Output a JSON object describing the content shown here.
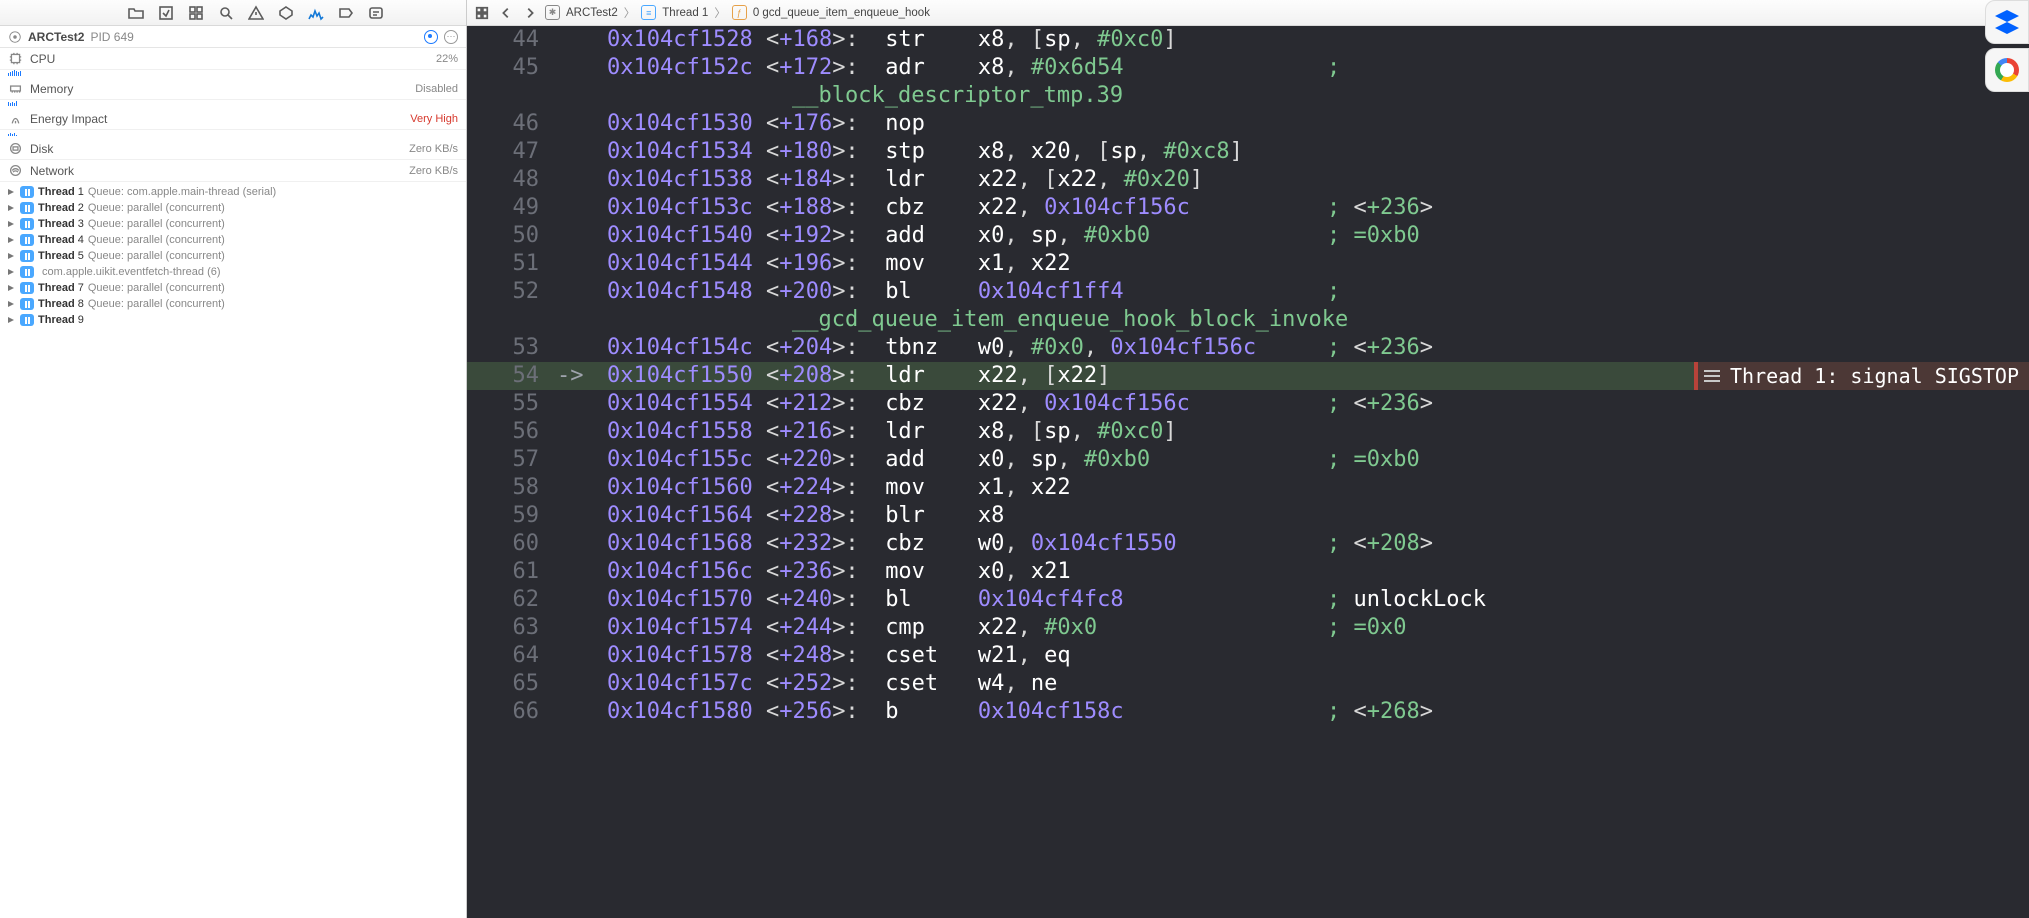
{
  "process": {
    "name": "ARCTest2",
    "pid": "PID 649"
  },
  "gauges": [
    {
      "label": "CPU",
      "value": "22%",
      "cls": "",
      "spark": [
        3,
        4,
        5,
        6,
        5,
        4,
        5
      ]
    },
    {
      "label": "Energy Impact",
      "value": "Very High",
      "cls": "red",
      "spark": [
        2,
        3,
        2,
        3,
        1
      ]
    },
    {
      "label": "Disk",
      "value": "Zero KB/s",
      "cls": "",
      "spark": []
    },
    {
      "label": "Network",
      "value": "Zero KB/s",
      "cls": "",
      "spark": []
    }
  ],
  "memory_status": "Disabled",
  "memory_label": "Memory",
  "threads": [
    {
      "n": "Thread 1",
      "q": "Queue: com.apple.main-thread (serial)"
    },
    {
      "n": "Thread 2",
      "q": "Queue: parallel (concurrent)"
    },
    {
      "n": "Thread 3",
      "q": "Queue: parallel (concurrent)"
    },
    {
      "n": "Thread 4",
      "q": "Queue: parallel (concurrent)"
    },
    {
      "n": "Thread 5",
      "q": "Queue: parallel (concurrent)"
    },
    {
      "n": "",
      "q": "com.apple.uikit.eventfetch-thread (6)"
    },
    {
      "n": "Thread 7",
      "q": "Queue: parallel (concurrent)"
    },
    {
      "n": "Thread 8",
      "q": "Queue: parallel (concurrent)"
    },
    {
      "n": "Thread 9",
      "q": ""
    }
  ],
  "breadcrumb": {
    "project": "ARCTest2",
    "thread": "Thread 1",
    "frame": "0 gcd_queue_item_enqueue_hook"
  },
  "error_banner": "Thread 1: signal SIGSTOP",
  "code": [
    {
      "ln": "44",
      "addr": "0x104cf1528",
      "off": "+168",
      "mn": "str",
      "ops": [
        [
          "reg",
          "x8"
        ],
        [
          "pun",
          ", ["
        ],
        [
          "reg",
          "sp"
        ],
        [
          "pun",
          ", "
        ],
        [
          "imm",
          "#0xc0"
        ],
        [
          "pun",
          "]"
        ]
      ]
    },
    {
      "ln": "45",
      "addr": "0x104cf152c",
      "off": "+172",
      "mn": "adr",
      "ops": [
        [
          "reg",
          "x8"
        ],
        [
          "pun",
          ", "
        ],
        [
          "imm",
          "#0x6d54"
        ]
      ],
      "cmt": ""
    },
    {
      "sym": "__block_descriptor_tmp.39"
    },
    {
      "ln": "46",
      "addr": "0x104cf1530",
      "off": "+176",
      "mn": "nop",
      "ops": []
    },
    {
      "ln": "47",
      "addr": "0x104cf1534",
      "off": "+180",
      "mn": "stp",
      "ops": [
        [
          "reg",
          "x8"
        ],
        [
          "pun",
          ", "
        ],
        [
          "reg",
          "x20"
        ],
        [
          "pun",
          ", ["
        ],
        [
          "reg",
          "sp"
        ],
        [
          "pun",
          ", "
        ],
        [
          "imm",
          "#0xc8"
        ],
        [
          "pun",
          "]"
        ]
      ]
    },
    {
      "ln": "48",
      "addr": "0x104cf1538",
      "off": "+184",
      "mn": "ldr",
      "ops": [
        [
          "reg",
          "x22"
        ],
        [
          "pun",
          ", ["
        ],
        [
          "reg",
          "x22"
        ],
        [
          "pun",
          ", "
        ],
        [
          "imm",
          "#0x20"
        ],
        [
          "pun",
          "]"
        ]
      ]
    },
    {
      "ln": "49",
      "addr": "0x104cf153c",
      "off": "+188",
      "mn": "cbz",
      "ops": [
        [
          "reg",
          "x22"
        ],
        [
          "pun",
          ", "
        ],
        [
          "addr",
          "0x104cf156c"
        ]
      ],
      "cmt": "<+236>"
    },
    {
      "ln": "50",
      "addr": "0x104cf1540",
      "off": "+192",
      "mn": "add",
      "ops": [
        [
          "reg",
          "x0"
        ],
        [
          "pun",
          ", "
        ],
        [
          "reg",
          "sp"
        ],
        [
          "pun",
          ", "
        ],
        [
          "imm",
          "#0xb0"
        ]
      ],
      "cmt": "=0xb0"
    },
    {
      "ln": "51",
      "addr": "0x104cf1544",
      "off": "+196",
      "mn": "mov",
      "ops": [
        [
          "reg",
          "x1"
        ],
        [
          "pun",
          ", "
        ],
        [
          "reg",
          "x22"
        ]
      ]
    },
    {
      "ln": "52",
      "addr": "0x104cf1548",
      "off": "+200",
      "mn": "bl",
      "ops": [
        [
          "addr",
          "0x104cf1ff4"
        ]
      ],
      "cmt": ""
    },
    {
      "sym": "__gcd_queue_item_enqueue_hook_block_invoke"
    },
    {
      "ln": "53",
      "addr": "0x104cf154c",
      "off": "+204",
      "mn": "tbnz",
      "ops": [
        [
          "reg",
          "w0"
        ],
        [
          "pun",
          ", "
        ],
        [
          "imm",
          "#0x0"
        ],
        [
          "pun",
          ", "
        ],
        [
          "addr",
          "0x104cf156c"
        ]
      ],
      "cmt": "<+236>"
    },
    {
      "ln": "54",
      "addr": "0x104cf1550",
      "off": "+208",
      "mn": "ldr",
      "ops": [
        [
          "reg",
          "x22"
        ],
        [
          "pun",
          ", ["
        ],
        [
          "reg",
          "x22"
        ],
        [
          "pun",
          "]"
        ]
      ],
      "hl": true,
      "arrow": "->",
      "err": true
    },
    {
      "ln": "55",
      "addr": "0x104cf1554",
      "off": "+212",
      "mn": "cbz",
      "ops": [
        [
          "reg",
          "x22"
        ],
        [
          "pun",
          ", "
        ],
        [
          "addr",
          "0x104cf156c"
        ]
      ],
      "cmt": "<+236>"
    },
    {
      "ln": "56",
      "addr": "0x104cf1558",
      "off": "+216",
      "mn": "ldr",
      "ops": [
        [
          "reg",
          "x8"
        ],
        [
          "pun",
          ", ["
        ],
        [
          "reg",
          "sp"
        ],
        [
          "pun",
          ", "
        ],
        [
          "imm",
          "#0xc0"
        ],
        [
          "pun",
          "]"
        ]
      ]
    },
    {
      "ln": "57",
      "addr": "0x104cf155c",
      "off": "+220",
      "mn": "add",
      "ops": [
        [
          "reg",
          "x0"
        ],
        [
          "pun",
          ", "
        ],
        [
          "reg",
          "sp"
        ],
        [
          "pun",
          ", "
        ],
        [
          "imm",
          "#0xb0"
        ]
      ],
      "cmt": "=0xb0"
    },
    {
      "ln": "58",
      "addr": "0x104cf1560",
      "off": "+224",
      "mn": "mov",
      "ops": [
        [
          "reg",
          "x1"
        ],
        [
          "pun",
          ", "
        ],
        [
          "reg",
          "x22"
        ]
      ]
    },
    {
      "ln": "59",
      "addr": "0x104cf1564",
      "off": "+228",
      "mn": "blr",
      "ops": [
        [
          "reg",
          "x8"
        ]
      ]
    },
    {
      "ln": "60",
      "addr": "0x104cf1568",
      "off": "+232",
      "mn": "cbz",
      "ops": [
        [
          "reg",
          "w0"
        ],
        [
          "pun",
          ", "
        ],
        [
          "addr",
          "0x104cf1550"
        ]
      ],
      "cmt": "<+208>"
    },
    {
      "ln": "61",
      "addr": "0x104cf156c",
      "off": "+236",
      "mn": "mov",
      "ops": [
        [
          "reg",
          "x0"
        ],
        [
          "pun",
          ", "
        ],
        [
          "reg",
          "x21"
        ]
      ]
    },
    {
      "ln": "62",
      "addr": "0x104cf1570",
      "off": "+240",
      "mn": "bl",
      "ops": [
        [
          "addr",
          "0x104cf4fc8"
        ]
      ],
      "cmtw": "unlockLock"
    },
    {
      "ln": "63",
      "addr": "0x104cf1574",
      "off": "+244",
      "mn": "cmp",
      "ops": [
        [
          "reg",
          "x22"
        ],
        [
          "pun",
          ", "
        ],
        [
          "imm",
          "#0x0"
        ]
      ],
      "cmt": "=0x0"
    },
    {
      "ln": "64",
      "addr": "0x104cf1578",
      "off": "+248",
      "mn": "cset",
      "ops": [
        [
          "reg",
          "w21"
        ],
        [
          "pun",
          ", "
        ],
        [
          "reg",
          "eq"
        ]
      ]
    },
    {
      "ln": "65",
      "addr": "0x104cf157c",
      "off": "+252",
      "mn": "cset",
      "ops": [
        [
          "reg",
          "w4"
        ],
        [
          "pun",
          ", "
        ],
        [
          "reg",
          "ne"
        ]
      ]
    },
    {
      "ln": "66",
      "addr": "0x104cf1580",
      "off": "+256",
      "mn": "b",
      "ops": [
        [
          "addr",
          "0x104cf158c"
        ]
      ],
      "cmt": "<+268>"
    }
  ]
}
